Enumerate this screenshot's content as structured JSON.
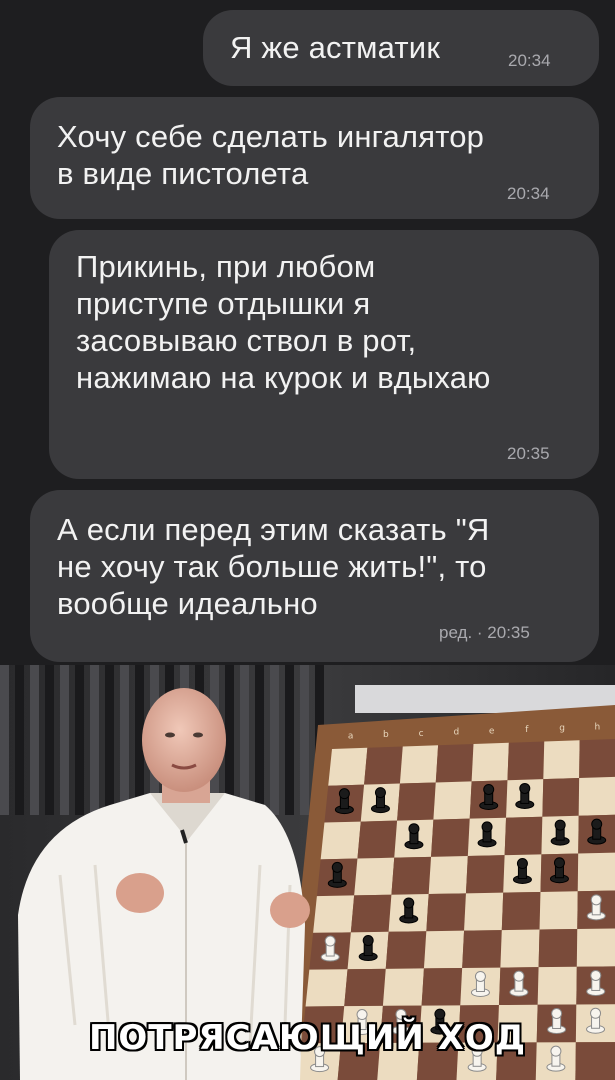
{
  "messages": [
    {
      "text": "Я же астматик",
      "time": "20:34"
    },
    {
      "text": "Хочу себе сделать ингалятор\nв виде пистолета",
      "time": "20:34"
    },
    {
      "text": "Прикинь, при любом\nприступе отдышки я\nзасовываю ствол в рот,\nнажимаю на курок и вдыхаю",
      "time": "20:35"
    },
    {
      "text": "А если перед этим сказать \"Я\nне хочу так больше жить!\", то\nвообще идеально",
      "time": "ред. · 20:35"
    }
  ],
  "meme": {
    "caption": "ПОТРЯСАЮЩИЙ ХОД",
    "board_files": [
      "a",
      "b",
      "c",
      "d",
      "e",
      "f",
      "g",
      "h"
    ]
  },
  "colors": {
    "bubble": "#3a3a3d",
    "background": "#1e1e20",
    "light_square": "#ecdcc0",
    "dark_square": "#7a4b3a",
    "frame": "#8a5a38"
  }
}
